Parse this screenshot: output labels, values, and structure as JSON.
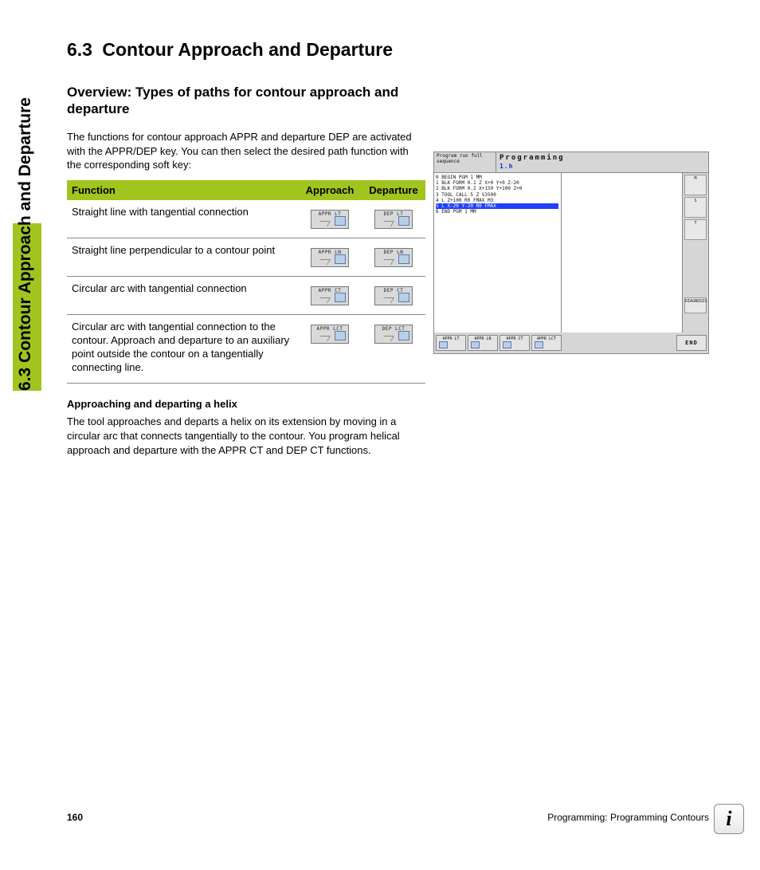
{
  "side_title": "6.3 Contour Approach and Departure",
  "heading_num": "6.3",
  "heading_title": "Contour Approach and Departure",
  "subheading": "Overview: Types of paths for contour approach and departure",
  "intro": "The functions for contour approach APPR and departure DEP are activated with the APPR/DEP key. You can then select the desired path function with the corresponding soft key:",
  "table": {
    "headers": {
      "c1": "Function",
      "c2": "Approach",
      "c3": "Departure"
    },
    "rows": [
      {
        "desc": "Straight line with tangential connection",
        "appr": "APPR LT",
        "dep": "DEP LT"
      },
      {
        "desc": "Straight line perpendicular to a contour point",
        "appr": "APPR LN",
        "dep": "DEP LN"
      },
      {
        "desc": "Circular arc with tangential connection",
        "appr": "APPR CT",
        "dep": "DEP CT"
      },
      {
        "desc": "Circular arc with tangential connection to the contour. Approach and departure to an auxiliary point outside the contour on a tangentially connecting line.",
        "appr": "APPR LCT",
        "dep": "DEP LCT"
      }
    ]
  },
  "helix_heading": "Approaching and departing a helix",
  "helix_body": "The tool approaches and departs a helix on its extension by moving in a circular arc that connects tangentially to the contour. You program helical approach and departure with the APPR CT and DEP CT functions.",
  "screenshot": {
    "mode_left": "Program run full sequence",
    "mode_right": "Programming",
    "file": "1.h",
    "code": [
      "0  BEGIN PGM 1 MM",
      "1  BLK FORM 0.1 Z X+0 Y+0 Z-20",
      "2  BLK FORM 0.2 X+150 Y+100 Z+0",
      "3  TOOL CALL 5 Z S3500",
      "4  L Z+100 R0 FMAX M3",
      "5  L X-20 Y-20 R0 FMAX",
      "6  END PGM 1 MM"
    ],
    "highlight_index": 5,
    "side_buttons": [
      "M",
      "S",
      "T",
      "DIAGNOSIS"
    ],
    "softkeys": [
      "APPR LT",
      "APPR LN",
      "APPR CT",
      "APPR LCT"
    ],
    "end_label": "END"
  },
  "footer": {
    "page": "160",
    "chapter": "Programming: Programming Contours"
  }
}
